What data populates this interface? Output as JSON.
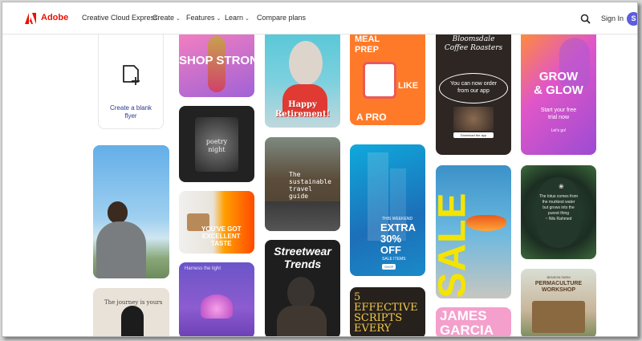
{
  "nav": {
    "brand": "Adobe",
    "links": [
      "Creative Cloud Express",
      "Create",
      "Features",
      "Learn",
      "Compare plans"
    ],
    "signin": "Sign In",
    "avatar_initial": "S"
  },
  "blank_card": {
    "label_line1": "Create a blank",
    "label_line2": "flyer"
  },
  "templates": {
    "shop_strong": {
      "title": "SHOP STRONG"
    },
    "happy_retirement": {
      "line1": "Happy",
      "line2": "Retirement!"
    },
    "meal_prep": {
      "line1": "MEAL",
      "line2": "PREP",
      "line3": "LIKE",
      "line4": "A PRO"
    },
    "bloomsdale": {
      "title1": "Bloomsdale",
      "title2": "Coffee Roasters",
      "body1": "You can now order",
      "body2": "from our app",
      "button": "Download the app"
    },
    "grow_glow": {
      "line1": "GROW",
      "line2": "& GLOW",
      "sub1": "Start your free",
      "sub2": "trial now",
      "cta": "Let's go!"
    },
    "poetry": {
      "line1": "poetry",
      "line2": "night"
    },
    "sustainable": {
      "line1": "The",
      "line2": "sustainable",
      "line3": "travel",
      "line4": "guide"
    },
    "extra_off": {
      "small": "THIS WEEKEND",
      "line1": "EXTRA",
      "line2": "30%",
      "line3": "OFF",
      "sub": "SALE ITEMS",
      "button": "SHOP"
    },
    "sale": {
      "word": "SALE"
    },
    "lotus_quote": {
      "l1": "The lotus comes from",
      "l2": "the murkiest water",
      "l3": "but grows into the",
      "l4": "purest thing",
      "attr": "~ Nils Rahmed"
    },
    "excellent_taste": {
      "line1": "YOU'VE GOT",
      "line2": "EXCELLENT",
      "line3": "TASTE"
    },
    "harness": {
      "text": "Harness the light"
    },
    "streetwear": {
      "line1": "Streetwear",
      "line2": "Trends"
    },
    "effective": {
      "line1": "5",
      "line2": "EFFECTIVE",
      "line3": "SCRIPTS",
      "line4": "EVERY"
    },
    "james": {
      "line1": "JAMES",
      "line2": "GARCIA"
    },
    "permaculture": {
      "small": "BENSON FARM",
      "line1": "PERMACULTURE",
      "line2": "WORKSHOP"
    },
    "journey": {
      "text": "The journey is yours"
    }
  }
}
